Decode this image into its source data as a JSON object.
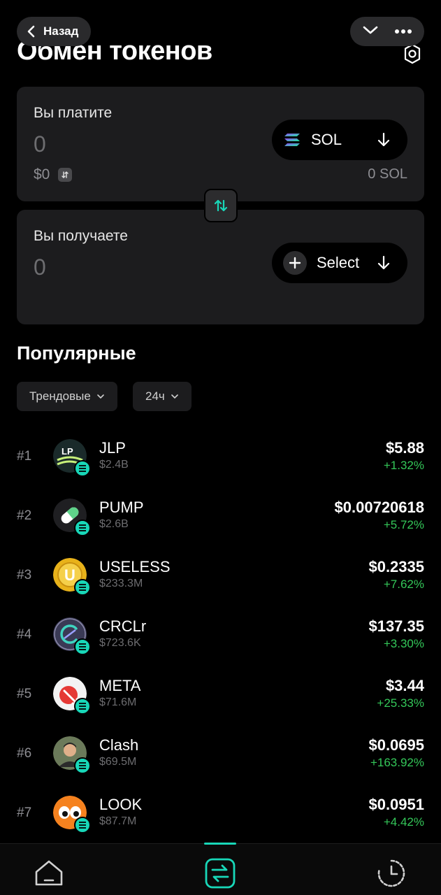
{
  "header": {
    "back_label": "Назад",
    "title": "Обмен токенов"
  },
  "pay": {
    "label": "Вы платите",
    "amount": "0",
    "usd": "$0",
    "token": "SOL",
    "balance": "0 SOL"
  },
  "receive": {
    "label": "Вы получаете",
    "amount": "0",
    "token": "Select"
  },
  "popular": {
    "title": "Популярные",
    "filter_sort": "Трендовые",
    "filter_period": "24ч",
    "tokens": [
      {
        "rank": "#1",
        "name": "JLP",
        "cap": "$2.4B",
        "price": "$5.88",
        "change": "+1.32%"
      },
      {
        "rank": "#2",
        "name": "PUMP",
        "cap": "$2.6B",
        "price": "$0.00720618",
        "change": "+5.72%"
      },
      {
        "rank": "#3",
        "name": "USELESS",
        "cap": "$233.3M",
        "price": "$0.2335",
        "change": "+7.62%"
      },
      {
        "rank": "#4",
        "name": "CRCLr",
        "cap": "$723.6K",
        "price": "$137.35",
        "change": "+3.30%"
      },
      {
        "rank": "#5",
        "name": "META",
        "cap": "$71.6M",
        "price": "$3.44",
        "change": "+25.33%"
      },
      {
        "rank": "#6",
        "name": "Clash",
        "cap": "$69.5M",
        "price": "$0.0695",
        "change": "+163.92%"
      },
      {
        "rank": "#7",
        "name": "LOOK",
        "cap": "$87.7M",
        "price": "$0.0951",
        "change": "+4.42%"
      }
    ]
  },
  "colors": {
    "accent": "#18d7b8",
    "positive": "#34c759",
    "card": "#1c1c1e"
  },
  "icons": {
    "avatar_1": "lp-logo-icon",
    "avatar_2": "pill-capsule-icon",
    "avatar_3": "gold-coin-u-icon",
    "avatar_4": "circle-c-icon",
    "avatar_5": "red-arrow-icon",
    "avatar_6": "person-photo-icon",
    "avatar_7": "cartoon-eyes-icon"
  }
}
